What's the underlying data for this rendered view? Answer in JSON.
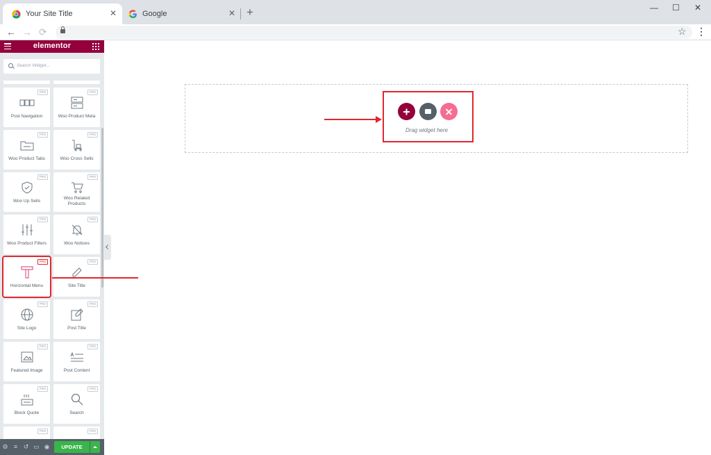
{
  "browser": {
    "tabs": [
      {
        "title": "Your Site Title",
        "active": true,
        "icon": "chrome-icon"
      },
      {
        "title": "Google",
        "active": false,
        "icon": "google-icon"
      }
    ],
    "new_tab": "+",
    "window_controls": {
      "minimize": "—",
      "maximize": "☐",
      "close": "✕"
    },
    "nav": {
      "back": "←",
      "forward": "→",
      "reload": "⟳"
    },
    "star": "☆",
    "menu": "⋮"
  },
  "panel": {
    "brand": "elementor",
    "search_placeholder": "Search Widget...",
    "pro_badge": "PRO",
    "widgets": [
      {
        "label": "Post Navigation",
        "icon": "post-navigation-icon"
      },
      {
        "label": "Woo Product Meta",
        "icon": "product-meta-icon"
      },
      {
        "label": "Woo Product Tabs",
        "icon": "product-tabs-icon"
      },
      {
        "label": "Woo Cross Sells",
        "icon": "cross-sells-icon"
      },
      {
        "label": "Woo Up Sells",
        "icon": "up-sells-icon"
      },
      {
        "label": "Woo Related Products",
        "icon": "related-products-icon"
      },
      {
        "label": "Woo Product Filters",
        "icon": "product-filters-icon"
      },
      {
        "label": "Woo Notices",
        "icon": "notices-icon"
      },
      {
        "label": "Horizontal Menu",
        "icon": "horizontal-menu-icon"
      },
      {
        "label": "Site Title",
        "icon": "site-title-icon"
      },
      {
        "label": "Site Logo",
        "icon": "site-logo-icon"
      },
      {
        "label": "Post Title",
        "icon": "post-title-icon"
      },
      {
        "label": "Featured Image",
        "icon": "featured-image-icon"
      },
      {
        "label": "Post Content",
        "icon": "post-content-icon"
      },
      {
        "label": "Block Quote",
        "icon": "block-quote-icon"
      },
      {
        "label": "Search",
        "icon": "search-widget-icon"
      }
    ],
    "footer": {
      "update_label": "UPDATE"
    }
  },
  "canvas": {
    "drag_text": "Drag widget here"
  },
  "colors": {
    "elementor_brand": "#93003c",
    "highlight": "#e0262e",
    "update_green": "#39b54a",
    "ekit_pink": "#f66c92"
  }
}
